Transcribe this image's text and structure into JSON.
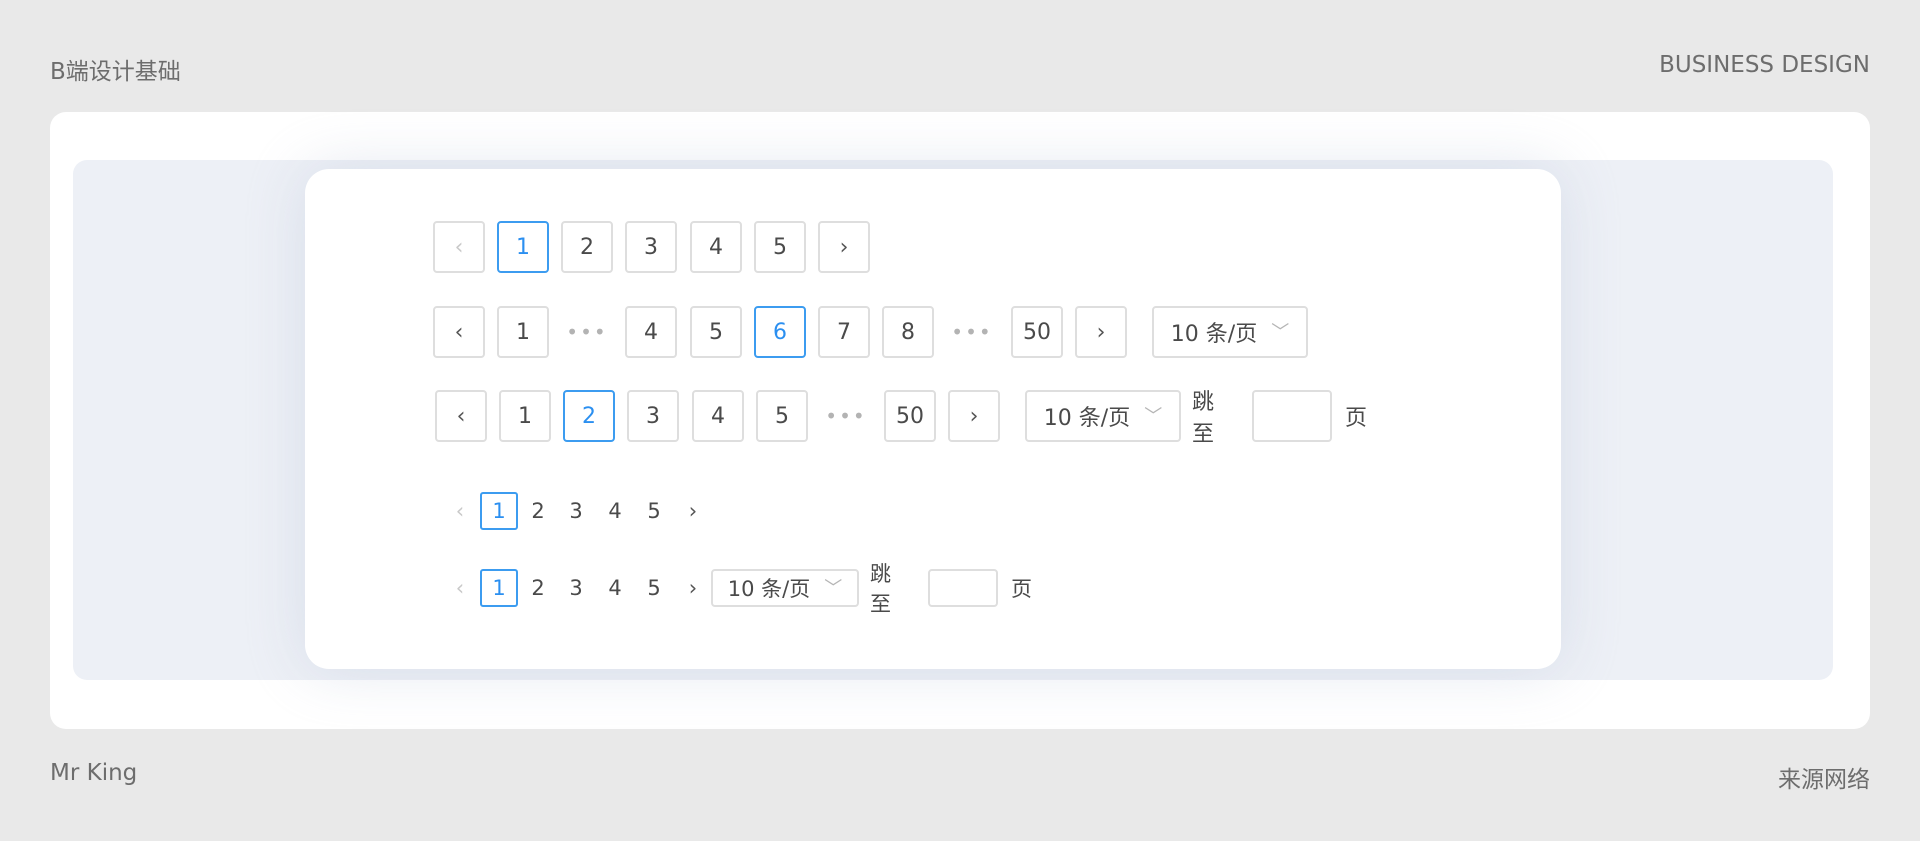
{
  "header": {
    "left": "B端设计基础",
    "right": "BUSINESS DESIGN"
  },
  "footer": {
    "left": "Mr King",
    "right": "来源网络"
  },
  "colors": {
    "active": "#2b8ff0",
    "border": "#dedede",
    "text": "#4a4a4a",
    "band": "#edf0f6"
  },
  "icons": {
    "prev": "‹",
    "next": "›",
    "chevron_down": "﹀",
    "ellipsis": "•••"
  },
  "row1": {
    "pages": [
      "1",
      "2",
      "3",
      "4",
      "5"
    ],
    "active": "1"
  },
  "row2": {
    "pages": [
      "1",
      "4",
      "5",
      "6",
      "7",
      "8",
      "50"
    ],
    "active": "6",
    "size_select": "10 条/页"
  },
  "row3": {
    "pages": [
      "1",
      "2",
      "3",
      "4",
      "5",
      "50"
    ],
    "active": "2",
    "size_select": "10 条/页",
    "jump_label": "跳至",
    "jump_value": "",
    "page_suffix": "页"
  },
  "row4": {
    "pages": [
      "1",
      "2",
      "3",
      "4",
      "5"
    ],
    "active": "1"
  },
  "row5": {
    "pages": [
      "1",
      "2",
      "3",
      "4",
      "5"
    ],
    "active": "1",
    "size_select": "10 条/页",
    "jump_label": "跳至",
    "jump_value": "",
    "page_suffix": "页"
  }
}
